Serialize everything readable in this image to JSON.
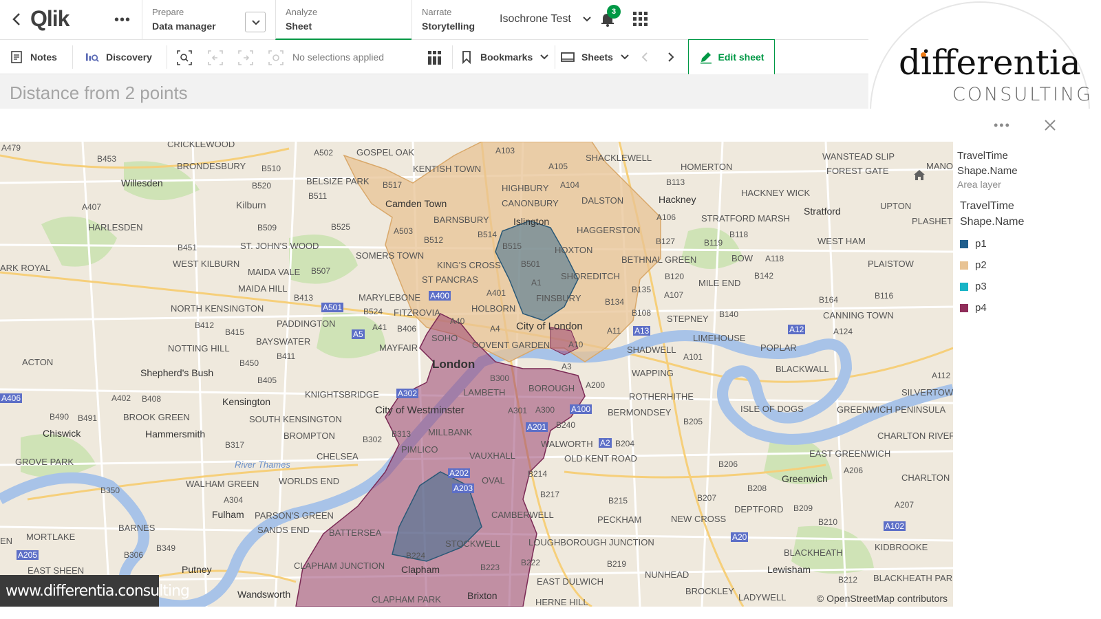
{
  "header": {
    "logo_text": "Qlik",
    "nav": [
      {
        "sup": "Prepare",
        "main": "Data manager"
      },
      {
        "sup": "Analyze",
        "main": "Sheet"
      },
      {
        "sup": "Narrate",
        "main": "Storytelling"
      }
    ],
    "app_title": "Isochrone Test",
    "notification_count": "3",
    "accent": "#009845"
  },
  "toolbar": {
    "notes": "Notes",
    "discovery": "Discovery",
    "selections": "No selections applied",
    "bookmarks": "Bookmarks",
    "sheets": "Sheets",
    "edit_sheet": "Edit sheet"
  },
  "sheet": {
    "title": "Distance from 2 points"
  },
  "branding": {
    "line1": "differentia",
    "line2": "CONSULTING",
    "url": "www.differentia.consulting"
  },
  "map": {
    "attribution": "© OpenStreetMap contributors",
    "labels": {
      "cricklewood": "CRICKLEWOOD",
      "brondesbury": "BRONDESBURY",
      "willesden": "Willesden",
      "harlesden": "HARLESDEN",
      "kilburn": "Kilburn",
      "st_johns_wood": "ST. JOHN'S WOOD",
      "west_kilburn": "WEST KILBURN",
      "maida_vale": "MAIDA VALE",
      "maida_hill": "MAIDA HILL",
      "north_kensington": "NORTH KENSINGTON",
      "paddington": "PADDINGTON",
      "bayswater": "BAYSWATER",
      "notting_hill": "NOTTING HILL",
      "acton": "ACTON",
      "shepherds_bush": "Shepherd's Bush",
      "kensington": "Kensington",
      "knightsbridge": "KNIGHTSBRIDGE",
      "south_kensington": "SOUTH KENSINGTON",
      "brook_green": "BROOK GREEN",
      "hammersmith": "Hammersmith",
      "chiswick": "Chiswick",
      "grove_park": "GROVE PARK",
      "brompton": "BROMPTON",
      "chelsea": "CHELSEA",
      "walham_green": "WALHAM GREEN",
      "worlds_end": "WORLDS END",
      "fulham": "Fulham",
      "parsons_green": "PARSON'S GREEN",
      "sands_end": "SANDS END",
      "barnes": "BARNES",
      "mortlake": "MORTLAKE",
      "east_sheen": "EAST SHEEN",
      "putney": "Putney",
      "wandsworth": "Wandsworth",
      "park_royal": "ARK ROYAL",
      "gospel_oak": "GOSPEL OAK",
      "kentish_town": "KENTISH TOWN",
      "belsize_park": "BELSIZE PARK",
      "camden_town": "Camden Town",
      "highbury": "HIGHBURY",
      "canonbury": "CANONBURY",
      "barnsbury": "BARNSBURY",
      "islington": "Islington",
      "somers_town": "SOMERS TOWN",
      "kings_cross": "KING'S CROSS",
      "st_pancras": "ST PANCRAS",
      "marylebone": "MARYLEBONE",
      "fitzrovia": "FITZROVIA",
      "holborn": "HOLBORN",
      "soho": "SOHO",
      "covent_garden": "COVENT GARDEN",
      "mayfair": "MAYFAIR",
      "london": "London",
      "city_of_london": "City of London",
      "lambeth": "LAMBETH",
      "city_of_westminster": "City of Westminster",
      "millbank": "MILLBANK",
      "pimlico": "PIMLICO",
      "vauxhall": "VAUXHALL",
      "oval": "OVAL",
      "battersea": "BATTERSEA",
      "stockwell": "STOCKWELL",
      "clapham_junction": "CLAPHAM JUNCTION",
      "clapham": "Clapham",
      "clapham_park": "CLAPHAM PARK",
      "brixton": "Brixton",
      "camberwell": "CAMBERWELL",
      "walworth": "WALWORTH",
      "borough": "BOROUGH",
      "shacklewell": "SHACKLEWELL",
      "dalston": "DALSTON",
      "haggerston": "HAGGERSTON",
      "hoxton": "HOXTON",
      "shoreditch": "SHOREDITCH",
      "finsbury": "FINSBURY",
      "homerton": "HOMERTON",
      "hackney": "Hackney",
      "hackney_wick": "HACKNEY WICK",
      "bethnal_green": "BETHNAL GREEN",
      "stratford_marsh": "STRATFORD MARSH",
      "stratford": "Stratford",
      "mile_end": "MILE END",
      "stepney": "STEPNEY",
      "bow": "BOW",
      "west_ham": "WEST HAM",
      "plaistow": "PLAISTOW",
      "upton": "UPTON",
      "plashet": "PLASHET",
      "wanstead_slip": "WANSTEAD SLIP",
      "forest_gate": "FOREST GATE",
      "manor": "MANO",
      "limehouse": "LIMEHOUSE",
      "shadwell": "SHADWELL",
      "wapping": "WAPPING",
      "poplar": "POPLAR",
      "blackwall": "BLACKWALL",
      "canning_town": "CANNING TOWN",
      "silvertown": "SILVERTOW",
      "rotherhithe": "ROTHERHITHE",
      "bermondsey": "BERMONDSEY",
      "isle_of_dogs": "ISLE OF DOGS",
      "greenwich_peninsula": "GREENWICH PENINSULA",
      "charlton_river": "CHARLTON RIVEF",
      "east_greenwich": "EAST GREENWICH",
      "greenwich": "Greenwich",
      "charlton": "CHARLTON",
      "old_kent_road": "OLD KENT ROAD",
      "peckham": "PECKHAM",
      "new_cross": "NEW CROSS",
      "deptford": "DEPTFORD",
      "blackheath": "BLACKHEATH",
      "kidbrooke": "KIDBROOKE",
      "lewisham": "Lewisham",
      "blackheath_park": "BLACKHEATH PAR",
      "loughborough": "LOUGHBOROUGH JUNCTION",
      "nunhead": "NUNHEAD",
      "brockley": "BROCKLEY",
      "east_dulwich": "EAST DULWICH",
      "ladywell": "LADYWELL",
      "herne_hill": "HERNE HILL",
      "river_thames": "River Thames",
      "en": "EN"
    },
    "roads": {
      "a479": "A479",
      "b453": "B453",
      "a407": "A407",
      "b510": "B510",
      "b520": "B520",
      "b511": "B511",
      "b509": "B509",
      "b525": "B525",
      "b451": "B451",
      "b507": "B507",
      "b413": "B413",
      "a501": "A501",
      "b412": "B412",
      "b415": "B415",
      "a5": "A5",
      "b411": "B411",
      "b450": "B450",
      "b405": "B405",
      "a402": "A402",
      "b408": "B408",
      "b490": "B490",
      "b491": "B491",
      "a406": "A406",
      "b317": "B317",
      "b302": "B302",
      "b350": "B350",
      "a304": "A304",
      "b349": "B349",
      "b306": "B306",
      "a205": "A205",
      "a502": "A502",
      "b517": "B517",
      "a503": "A503",
      "b512": "B512",
      "b514": "B514",
      "b515": "B515",
      "b501": "B501",
      "a1": "A1",
      "a401": "A401",
      "a400": "A400",
      "b524": "B524",
      "a40": "A40",
      "a41": "A41",
      "b406": "B406",
      "a4": "A4",
      "b300": "B300",
      "a3": "A3",
      "a10": "A10",
      "a302": "A302",
      "b313": "B313",
      "a301": "A301",
      "a300": "A300",
      "a201": "A201",
      "b240": "B240",
      "a100": "A100",
      "a202": "A202",
      "a203": "A203",
      "b214": "B214",
      "b217": "B217",
      "b224": "B224",
      "b223": "B223",
      "b222": "B222",
      "a103": "A103",
      "a105": "A105",
      "a104": "A104",
      "b113": "B113",
      "a106": "A106",
      "b127": "B127",
      "b119": "B119",
      "b118": "B118",
      "a118": "A118",
      "b142": "B142",
      "b120": "B120",
      "b135": "B135",
      "a107": "A107",
      "b134": "B134",
      "b108": "B108",
      "b140": "B140",
      "a11": "A11",
      "a13": "A13",
      "a101": "A101",
      "a12": "A12",
      "a124": "A124",
      "b164": "B164",
      "b116": "B116",
      "a112": "A112",
      "a200": "A200",
      "b205": "B205",
      "a2": "A2",
      "b204": "B204",
      "b206": "B206",
      "b215": "B215",
      "b207": "B207",
      "b208": "B208",
      "b209": "B209",
      "a206": "A206",
      "a207": "A207",
      "b210": "B210",
      "a102": "A102",
      "a20": "A20",
      "b219": "B219",
      "b212": "B212"
    },
    "colors": {
      "p1": "#1f5e8c",
      "p2": "#e8c394",
      "p3": "#17b4c6",
      "p4": "#8f2d5a",
      "water": "#a8c3e8",
      "land": "#efe9dd",
      "park": "#c9dfb1"
    }
  },
  "legend": {
    "field1": "TravelTime",
    "field2": "Shape.Name",
    "layer": "Area layer",
    "group1": "TravelTime",
    "group2": "Shape.Name",
    "items": [
      {
        "label": "p1",
        "color": "#1f5e8c"
      },
      {
        "label": "p2",
        "color": "#e8c394"
      },
      {
        "label": "p3",
        "color": "#17b4c6"
      },
      {
        "label": "p4",
        "color": "#8f2d5a"
      }
    ]
  }
}
